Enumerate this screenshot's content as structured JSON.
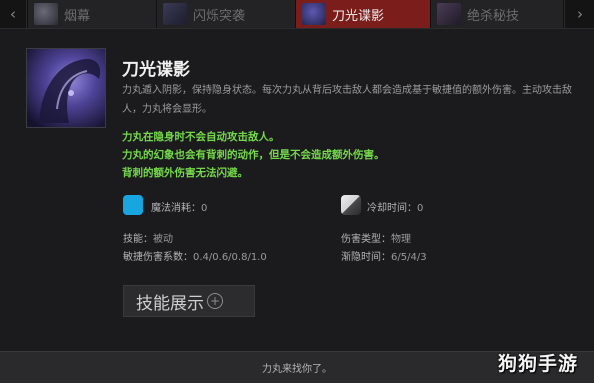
{
  "tabs": [
    {
      "label": "烟幕",
      "icon": "smoke-icon",
      "active": false
    },
    {
      "label": "闪烁突袭",
      "icon": "blink-strike-icon",
      "active": false
    },
    {
      "label": "刀光谍影",
      "icon": "blur-icon",
      "active": true
    },
    {
      "label": "绝杀秘技",
      "icon": "backstab-icon",
      "active": false
    }
  ],
  "nav": {
    "prev": "‹",
    "next": "›"
  },
  "skill": {
    "title": "刀光谍影",
    "icon": "riki-portrait-icon",
    "description": "力丸遁入阴影，保持隐身状态。每次力丸从背后攻击敌人都会造成基于敏捷值的额外伤害。主动攻击敌人，力丸将会显形。",
    "notes": [
      "力丸在隐身时不会自动攻击敌人。",
      "力丸的幻象也会有背刺的动作，但是不会造成额外伤害。",
      "背刺的额外伤害无法闪避。"
    ]
  },
  "stats": {
    "mana_cost": {
      "label": "魔法消耗：",
      "value": "0"
    },
    "cooldown": {
      "label": "冷却时间：",
      "value": "0"
    },
    "ability": {
      "label": "技能：",
      "value": "被动"
    },
    "damage_type": {
      "label": "伤害类型：",
      "value": "物理"
    },
    "agility_damage": {
      "label": "敏捷伤害系数：",
      "value": "0.4/0.6/0.8/1.0"
    },
    "fade_time": {
      "label": "渐隐时间：",
      "value": "6/5/4/3"
    }
  },
  "demo": {
    "label": "技能展示",
    "plus": "+"
  },
  "footer": {
    "quote": "力丸来找你了。"
  },
  "watermark": "狗狗手游",
  "colors": {
    "active_tab": "#7b1d1a",
    "notes": "#74d84a",
    "mana": "#18a6e0"
  }
}
